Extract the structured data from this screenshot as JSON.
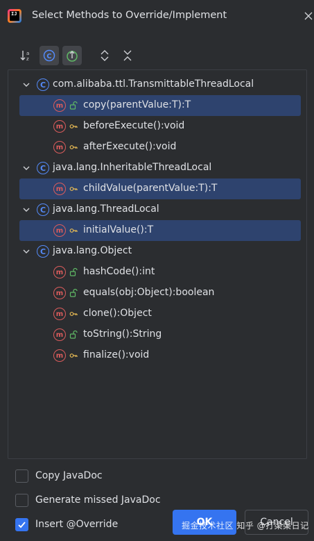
{
  "window": {
    "title": "Select Methods to Override/Implement"
  },
  "toolbar": {
    "buttons": [
      {
        "icon": "sort-alpha-icon",
        "active": false
      },
      {
        "icon": "show-classes-icon",
        "active": true
      },
      {
        "icon": "show-inherited-icon",
        "active": true
      },
      {
        "icon": "expand-all-icon",
        "active": false
      },
      {
        "icon": "collapse-all-icon",
        "active": false
      }
    ]
  },
  "tree": [
    {
      "class_name": "com.alibaba.ttl.TransmittableThreadLocal",
      "methods": [
        {
          "label": "copy(parentValue:T):T",
          "visibility": "public",
          "selected": true
        },
        {
          "label": "beforeExecute():void",
          "visibility": "protected",
          "selected": false
        },
        {
          "label": "afterExecute():void",
          "visibility": "protected",
          "selected": false
        }
      ]
    },
    {
      "class_name": "java.lang.InheritableThreadLocal",
      "methods": [
        {
          "label": "childValue(parentValue:T):T",
          "visibility": "protected",
          "selected": true
        }
      ]
    },
    {
      "class_name": "java.lang.ThreadLocal",
      "methods": [
        {
          "label": "initialValue():T",
          "visibility": "protected",
          "selected": true
        }
      ]
    },
    {
      "class_name": "java.lang.Object",
      "methods": [
        {
          "label": "hashCode():int",
          "visibility": "public",
          "selected": false
        },
        {
          "label": "equals(obj:Object):boolean",
          "visibility": "public",
          "selected": false
        },
        {
          "label": "clone():Object",
          "visibility": "protected",
          "selected": false
        },
        {
          "label": "toString():String",
          "visibility": "public",
          "selected": false
        },
        {
          "label": "finalize():void",
          "visibility": "protected",
          "selected": false
        }
      ]
    }
  ],
  "options": [
    {
      "label": "Copy JavaDoc",
      "checked": false
    },
    {
      "label": "Generate missed JavaDoc",
      "checked": false
    },
    {
      "label": "Insert @Override",
      "checked": true
    }
  ],
  "buttons": {
    "ok": "OK",
    "cancel": "Cancel"
  },
  "watermark": "掘金技术社区  知乎 @打渠渠日记",
  "colors": {
    "background": "#2b2d30",
    "selection": "#2e436e",
    "accent": "#3574f0",
    "class_icon": "#548af7",
    "method_icon": "#db5c5c",
    "public_lock": "#5fb865",
    "protected_key": "#e5b954"
  }
}
